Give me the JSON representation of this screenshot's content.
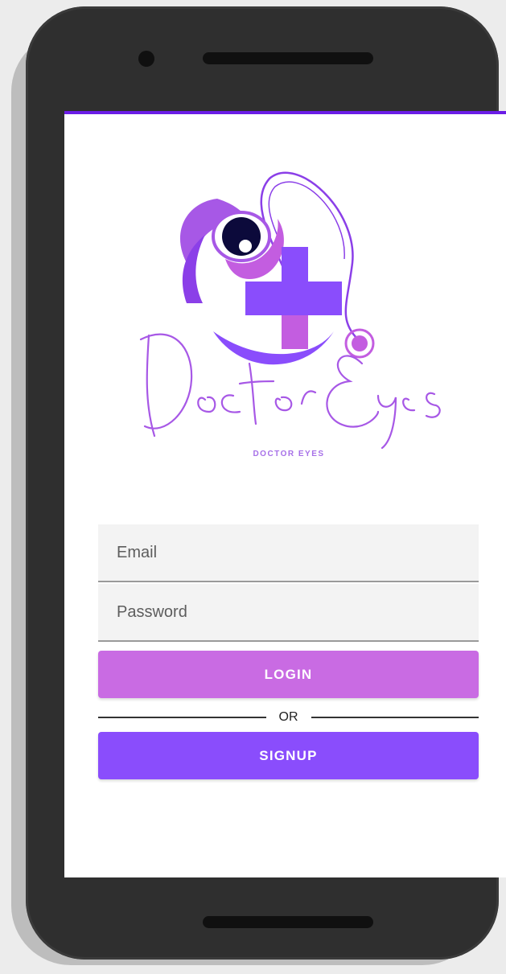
{
  "app": {
    "logo_caption": "DOCTOR EYES",
    "brand_colors": {
      "primary": "#6b1de6",
      "purple": "#8a4dfc",
      "orchid": "#c96be3",
      "navy": "#0c0a3b"
    }
  },
  "form": {
    "email_placeholder": "Email",
    "password_placeholder": "Password",
    "login_label": "LOGIN",
    "or_label": "OR",
    "signup_label": "SIGNUP"
  },
  "icons": [
    "eye-icon",
    "medical-cross-icon",
    "stethoscope-icon"
  ]
}
